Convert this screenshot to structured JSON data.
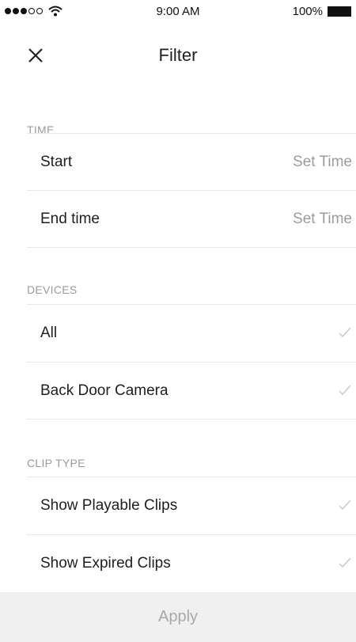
{
  "status_bar": {
    "time": "9:00 AM",
    "battery": "100%",
    "signal_icon": "signal-dots-icon",
    "wifi_icon": "wifi-icon",
    "battery_icon": "battery-icon"
  },
  "nav": {
    "title": "Filter",
    "close_icon": "close-icon"
  },
  "sections": {
    "time": {
      "header": "TIME",
      "rows": [
        {
          "label": "Start",
          "value": "Set Time"
        },
        {
          "label": "End time",
          "value": "Set Time"
        }
      ]
    },
    "devices": {
      "header": "DEVICES",
      "rows": [
        {
          "label": "All",
          "checked": true
        },
        {
          "label": "Back Door Camera",
          "checked": true
        }
      ]
    },
    "clip_type": {
      "header": "CLIP TYPE",
      "rows": [
        {
          "label": "Show Playable Clips",
          "checked": true
        },
        {
          "label": "Show Expired Clips",
          "checked": true
        }
      ]
    }
  },
  "footer": {
    "apply_label": "Apply"
  },
  "colors": {
    "section_header": "#9a9a9a",
    "row_value": "#9c9c9c",
    "check": "#c8c8c8",
    "apply_bg": "#f0f0f0",
    "apply_text": "#a9a9a9"
  }
}
